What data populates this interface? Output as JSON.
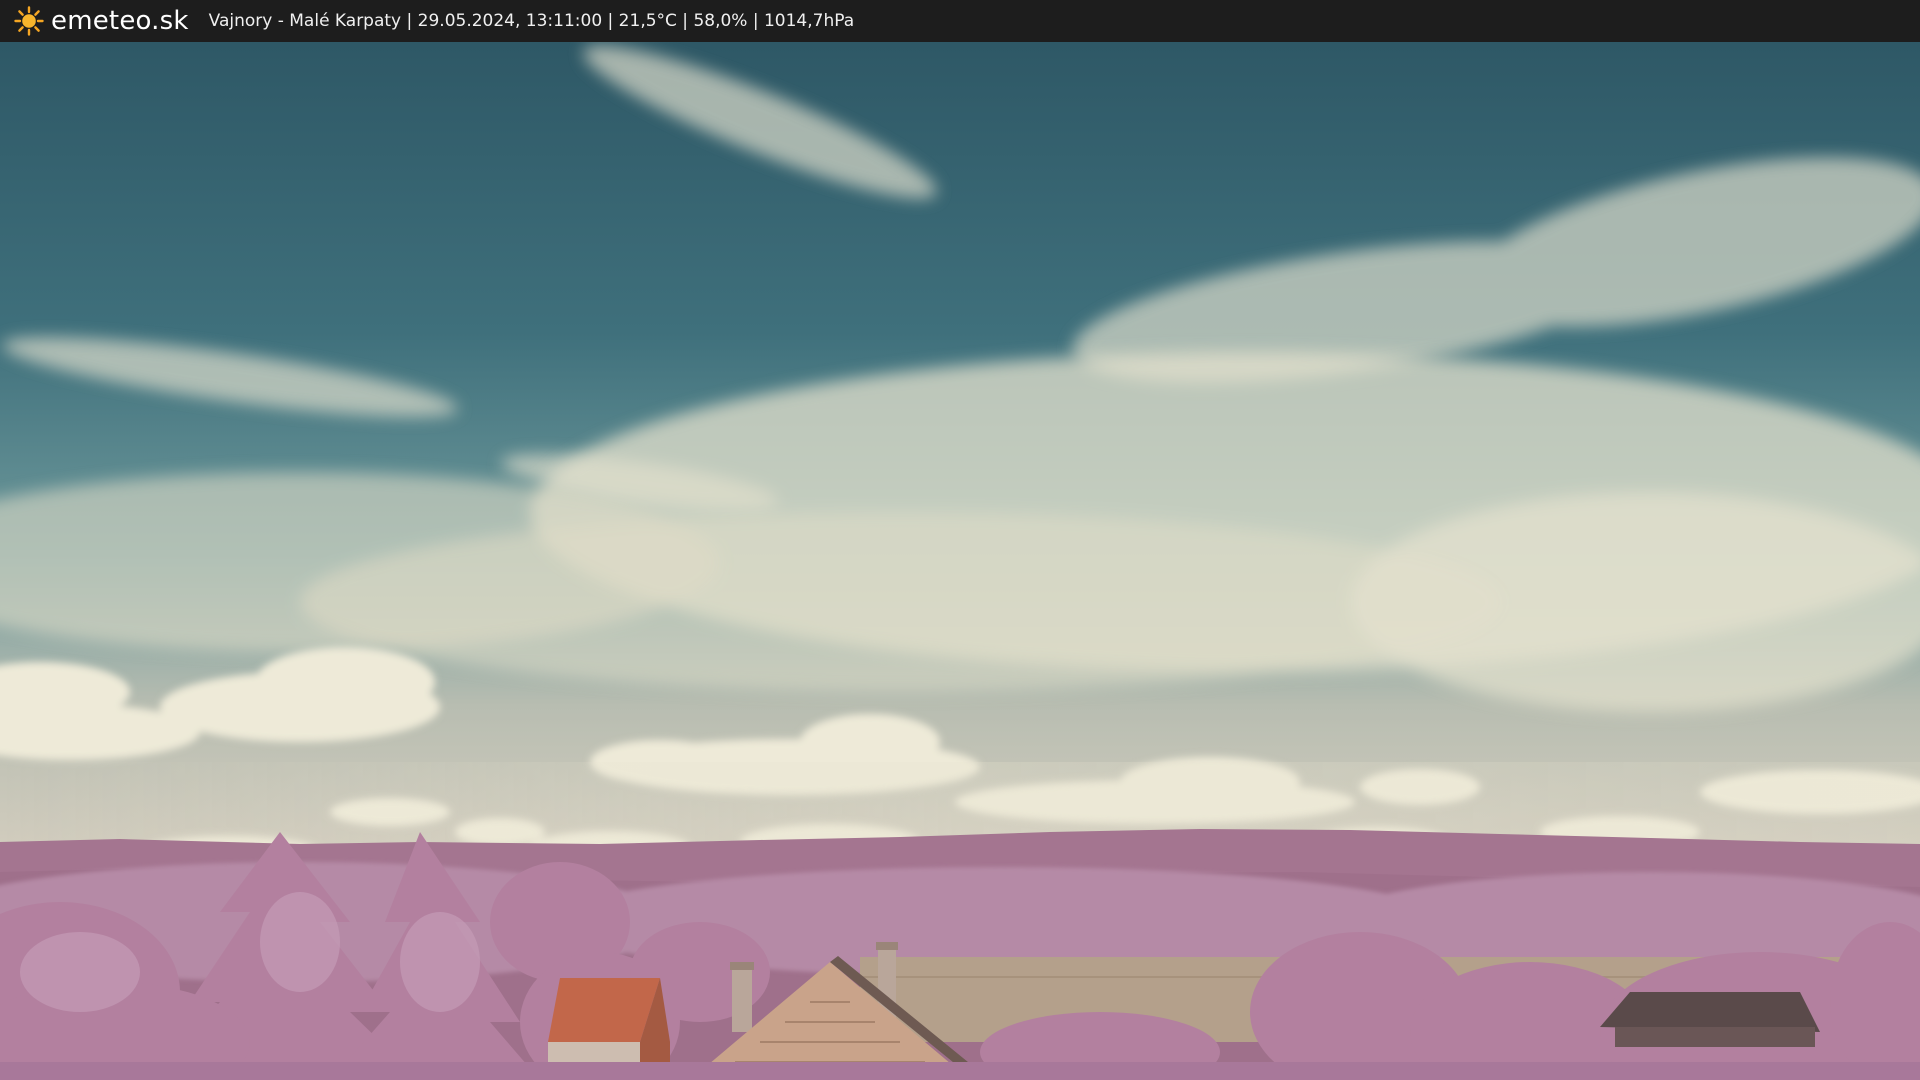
{
  "site": {
    "name": "emeteo.sk",
    "logo_icon": "sun-icon",
    "accent_color": "#f5a623"
  },
  "caption": {
    "text": "Vajnory - Malé Karpaty | 29.05.2024, 13:11:00 | 21,5°C | 58,0% | 1014,7hPa"
  },
  "colors": {
    "bar": "#1d1d1d",
    "sky_top": "#2f5a68",
    "sky_mid": "#5e8e97",
    "cloud": "#e4e1cf",
    "hills": "#a77a95",
    "foliage": "#b98aa9",
    "roof": "#c86a4a",
    "field": "#b3a18c"
  }
}
